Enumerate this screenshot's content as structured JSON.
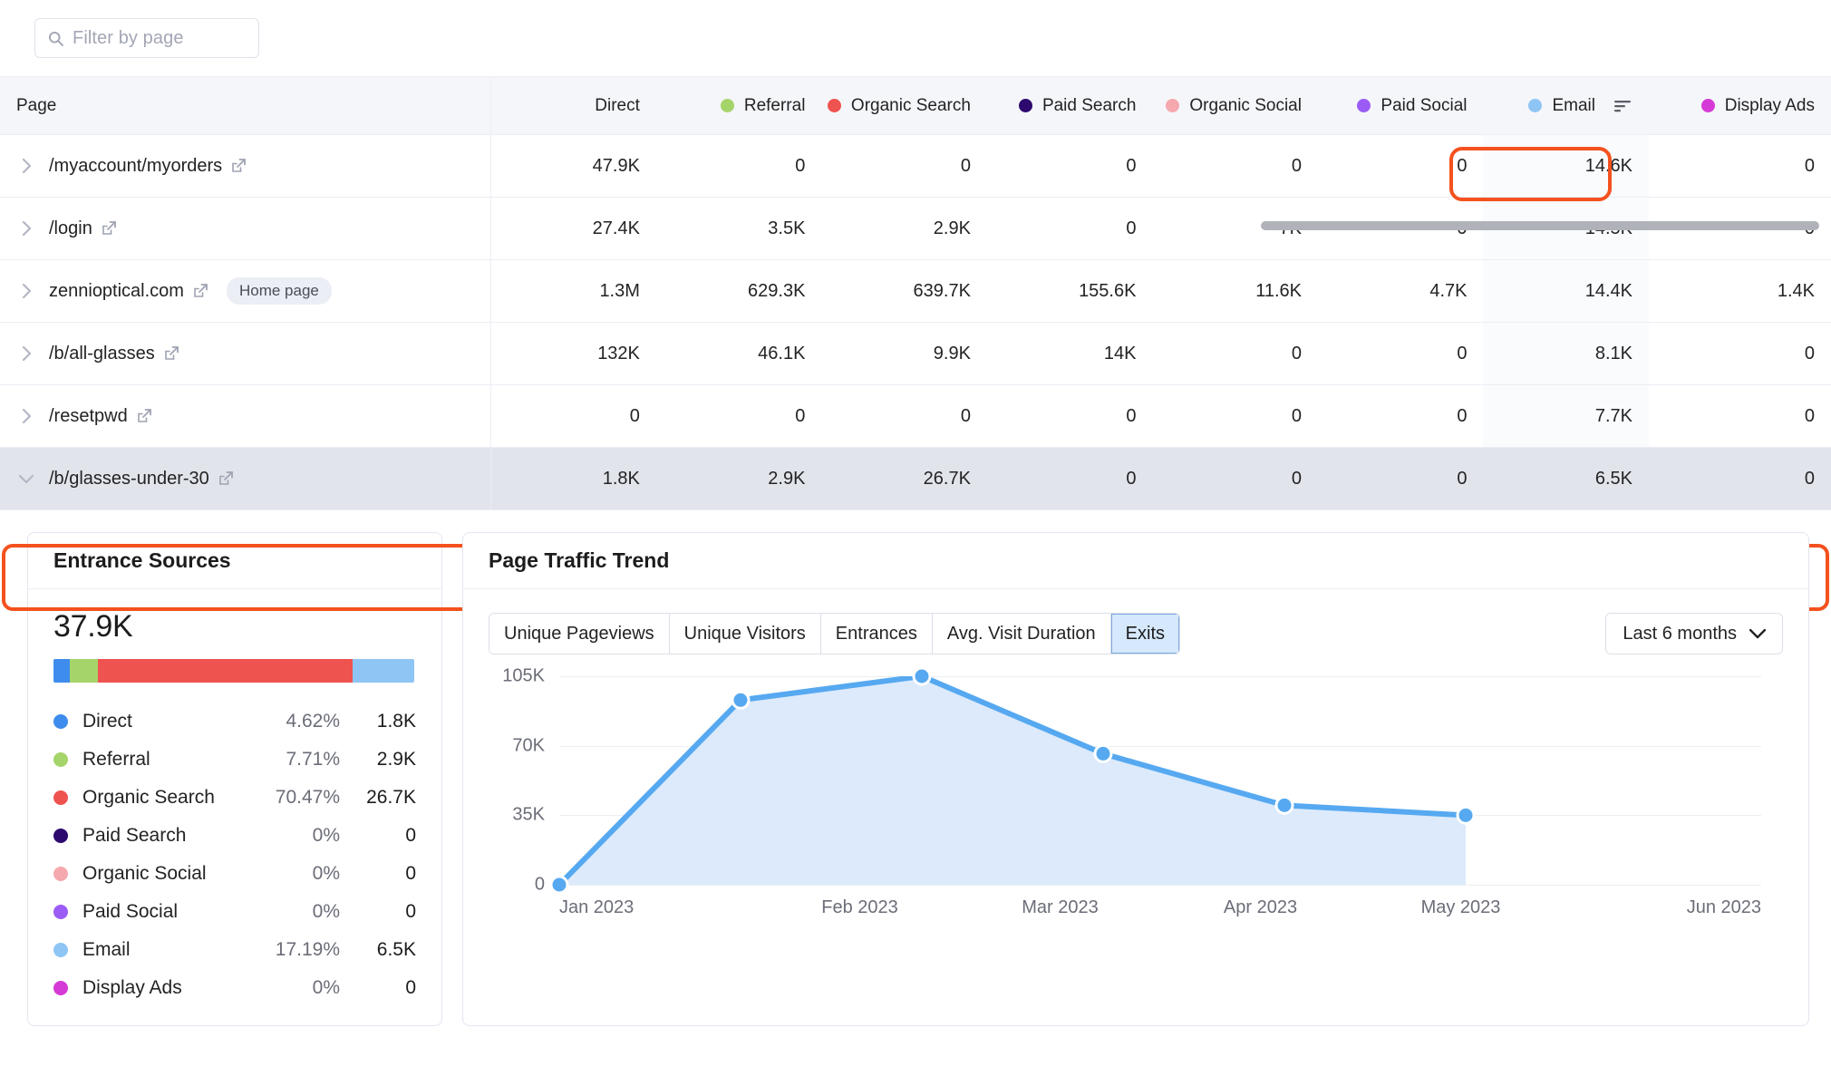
{
  "filter": {
    "placeholder": "Filter by page",
    "icon": "search-icon"
  },
  "table": {
    "columns": [
      {
        "label": "Page",
        "color": null
      },
      {
        "label": "Direct",
        "color": null
      },
      {
        "label": "Referral",
        "color": "#a5d46a"
      },
      {
        "label": "Organic Search",
        "color": "#ef5350"
      },
      {
        "label": "Paid Search",
        "color": "#2e0a6e"
      },
      {
        "label": "Organic Social",
        "color": "#f5a8ae"
      },
      {
        "label": "Paid Social",
        "color": "#9b5cf6"
      },
      {
        "label": "Email",
        "color": "#8ec5f5"
      },
      {
        "label": "Display Ads",
        "color": "#d63ad6"
      }
    ],
    "sorted_column": "Email",
    "rows": [
      {
        "page": "/myaccount/myorders",
        "badge": null,
        "expanded": false,
        "selected": false,
        "values": [
          "47.9K",
          "0",
          "0",
          "0",
          "0",
          "0",
          "14.6K",
          "0"
        ]
      },
      {
        "page": "/login",
        "badge": null,
        "expanded": false,
        "selected": false,
        "values": [
          "27.4K",
          "3.5K",
          "2.9K",
          "0",
          "7K",
          "0",
          "14.5K",
          "0"
        ]
      },
      {
        "page": "zennioptical.com",
        "badge": "Home page",
        "expanded": false,
        "selected": false,
        "values": [
          "1.3M",
          "629.3K",
          "639.7K",
          "155.6K",
          "11.6K",
          "4.7K",
          "14.4K",
          "1.4K"
        ]
      },
      {
        "page": "/b/all-glasses",
        "badge": null,
        "expanded": false,
        "selected": false,
        "values": [
          "132K",
          "46.1K",
          "9.9K",
          "14K",
          "0",
          "0",
          "8.1K",
          "0"
        ]
      },
      {
        "page": "/resetpwd",
        "badge": null,
        "expanded": false,
        "selected": false,
        "values": [
          "0",
          "0",
          "0",
          "0",
          "0",
          "0",
          "7.7K",
          "0"
        ]
      },
      {
        "page": "/b/glasses-under-30",
        "badge": null,
        "expanded": true,
        "selected": true,
        "values": [
          "1.8K",
          "2.9K",
          "26.7K",
          "0",
          "0",
          "0",
          "6.5K",
          "0"
        ]
      }
    ]
  },
  "entrance_sources": {
    "title": "Entrance Sources",
    "total": "37.9K",
    "items": [
      {
        "label": "Direct",
        "pct": "4.62%",
        "value": "1.8K",
        "color": "#3e8ced",
        "share": 4.62
      },
      {
        "label": "Referral",
        "pct": "7.71%",
        "value": "2.9K",
        "color": "#a5d46a",
        "share": 7.71
      },
      {
        "label": "Organic Search",
        "pct": "70.47%",
        "value": "26.7K",
        "color": "#ef5350",
        "share": 70.47
      },
      {
        "label": "Paid Search",
        "pct": "0%",
        "value": "0",
        "color": "#2e0a6e",
        "share": 0
      },
      {
        "label": "Organic Social",
        "pct": "0%",
        "value": "0",
        "color": "#f5a8ae",
        "share": 0
      },
      {
        "label": "Paid Social",
        "pct": "0%",
        "value": "0",
        "color": "#9b5cf6",
        "share": 0
      },
      {
        "label": "Email",
        "pct": "17.19%",
        "value": "6.5K",
        "color": "#8ec5f5",
        "share": 17.19
      },
      {
        "label": "Display Ads",
        "pct": "0%",
        "value": "0",
        "color": "#d63ad6",
        "share": 0
      }
    ]
  },
  "page_traffic_trend": {
    "title": "Page Traffic Trend",
    "metrics": [
      "Unique Pageviews",
      "Unique Visitors",
      "Entrances",
      "Avg. Visit Duration",
      "Exits"
    ],
    "active_metric": "Exits",
    "date_range": "Last 6 months",
    "dropdown_icon": "chevron-down-icon"
  },
  "chart_data": {
    "type": "area",
    "title": "Page Traffic Trend",
    "xlabel": "",
    "ylabel": "",
    "x": [
      "Jan 2023",
      "Feb 2023",
      "Mar 2023",
      "Apr 2023",
      "May 2023",
      "Jun 2023"
    ],
    "values": [
      0,
      93000,
      105000,
      66000,
      40000,
      35000
    ],
    "ytick_labels": [
      "0",
      "35K",
      "70K",
      "105K"
    ],
    "yticks": [
      0,
      35000,
      70000,
      105000
    ],
    "ylim": [
      0,
      105000
    ],
    "grid": true,
    "legend": "none",
    "series_name": "Exits",
    "line_color": "#56a9f0",
    "fill_color": "#dceafb"
  }
}
